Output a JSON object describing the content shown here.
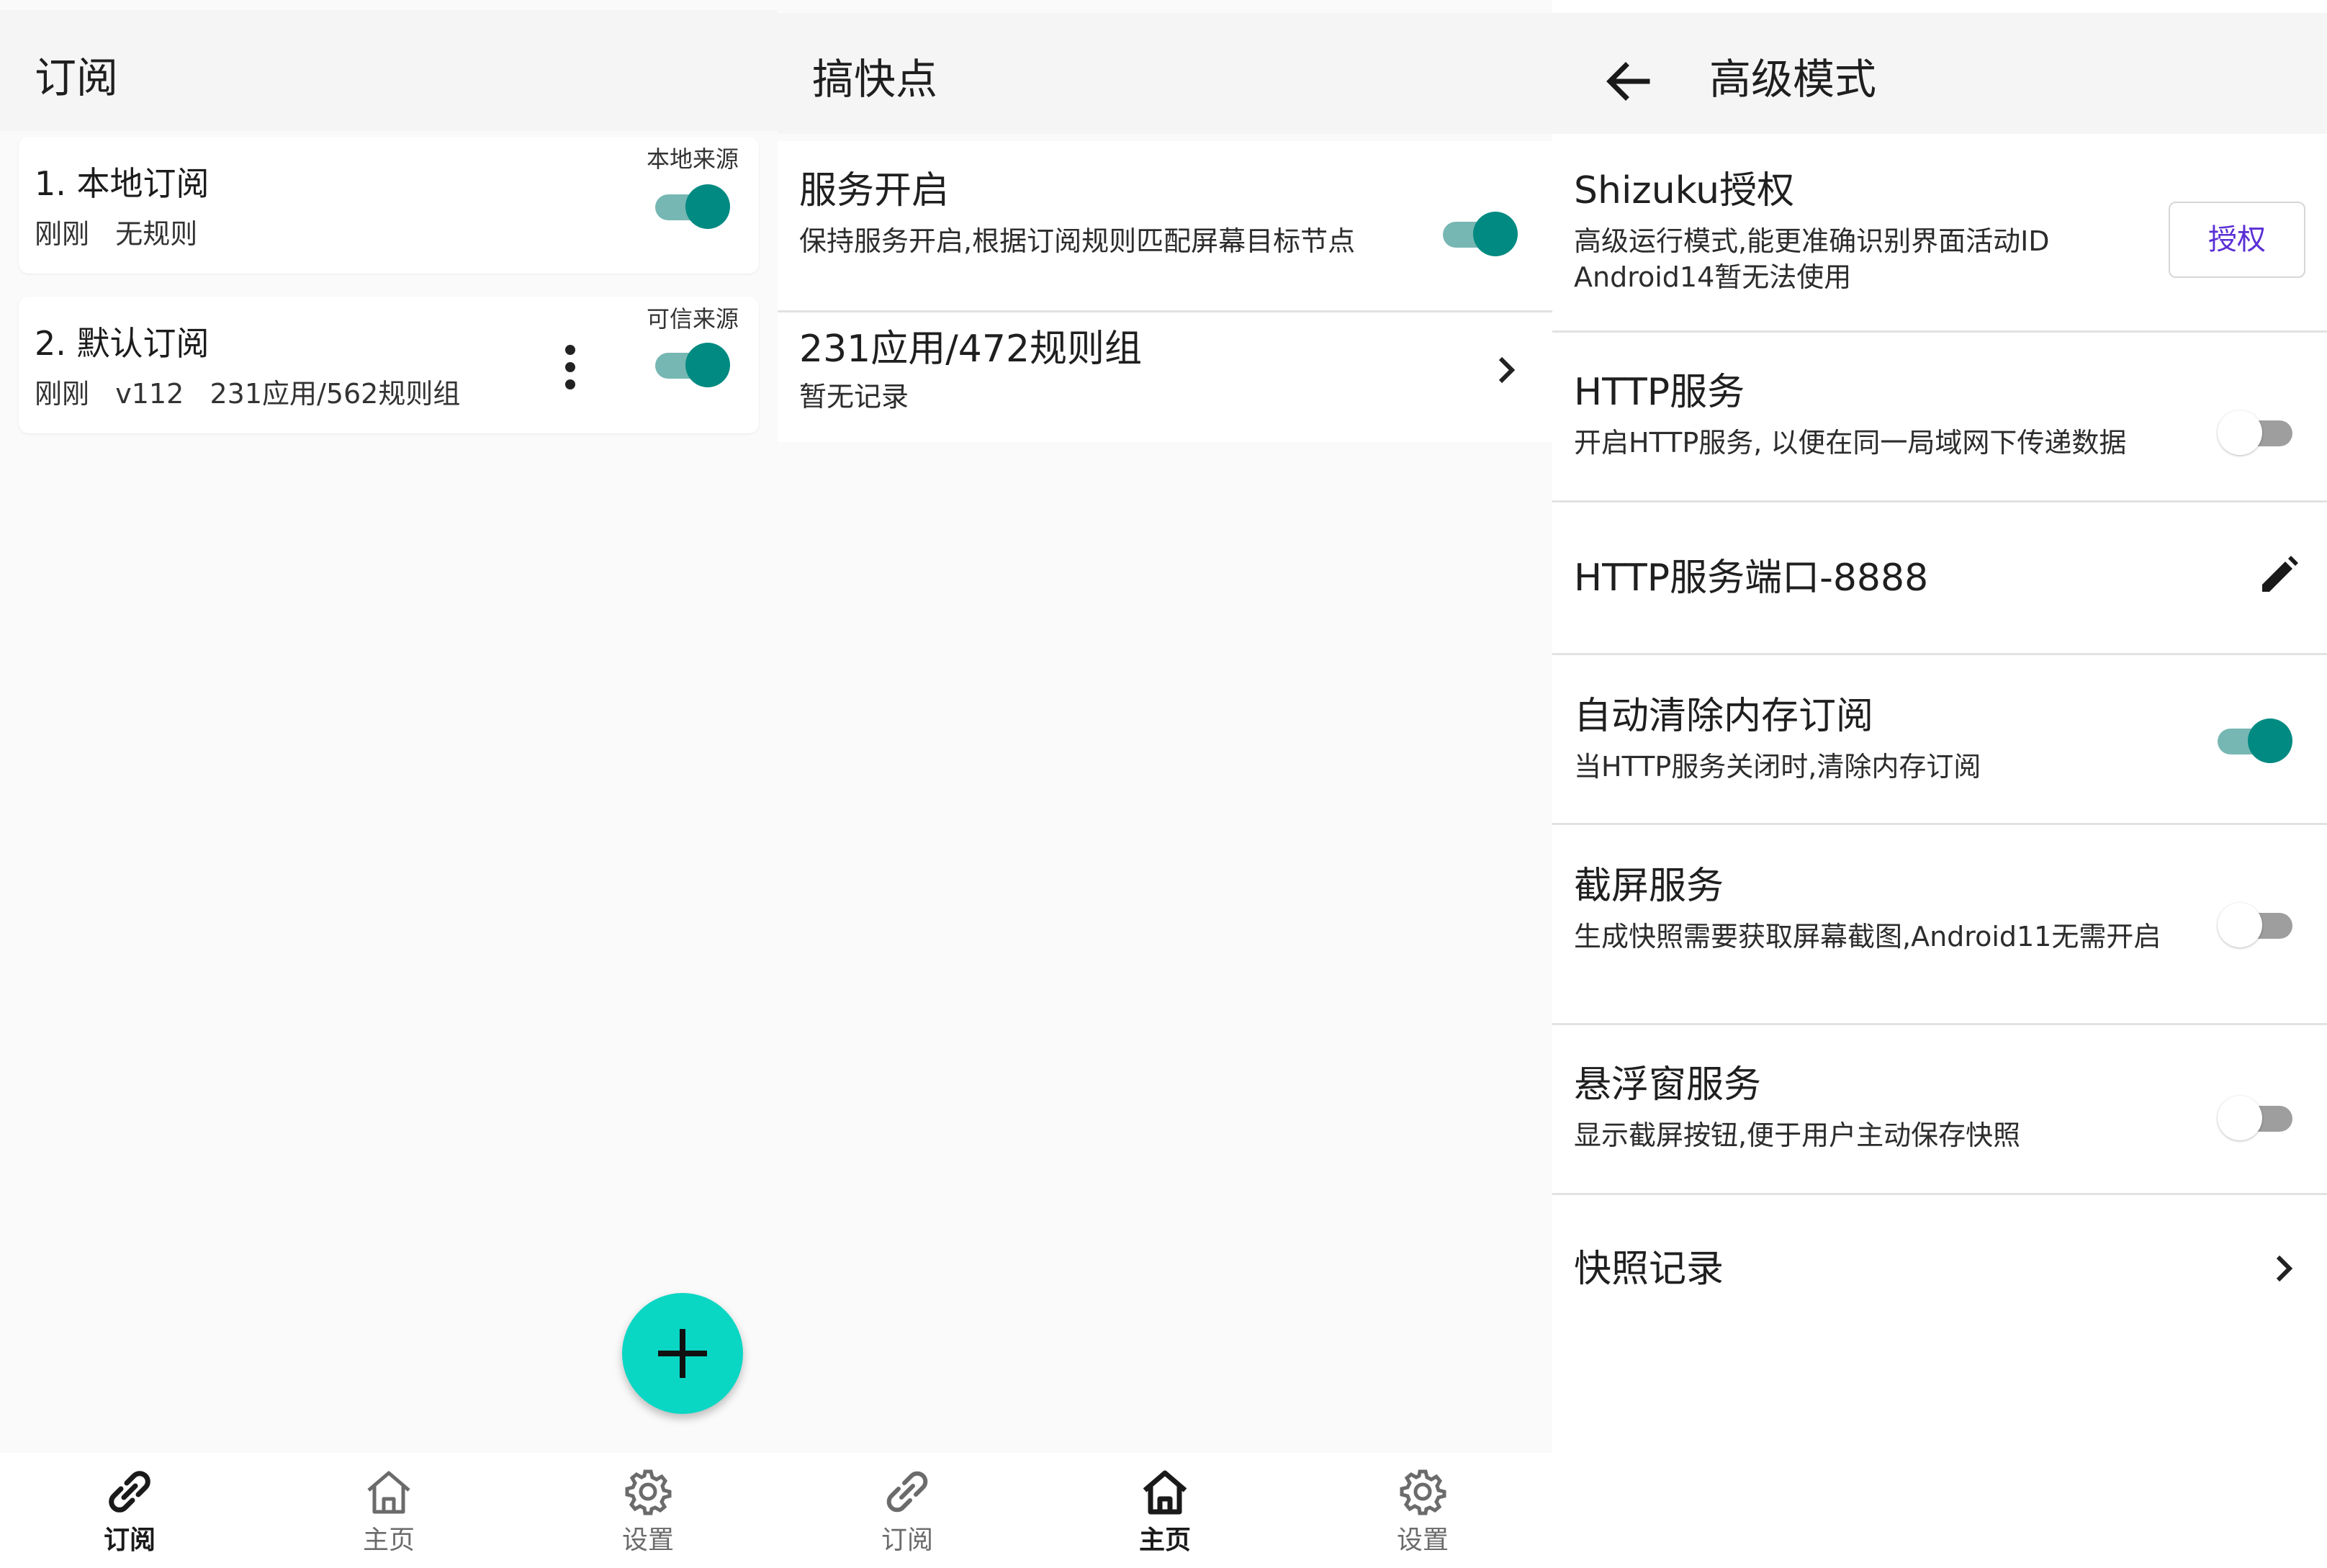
{
  "panels": [
    {
      "title": "订阅",
      "subscriptions": [
        {
          "title": "1. 本地订阅",
          "meta": "刚刚   无规则",
          "tag": "本地来源",
          "enabled": true
        },
        {
          "title": "2. 默认订阅",
          "meta": "刚刚   v112   231应用/562规则组",
          "tag": "可信来源",
          "enabled": true
        }
      ],
      "fab_icon": "plus-icon",
      "nav_active": "订阅"
    },
    {
      "title": "搞快点",
      "service": {
        "title": "服务开启",
        "desc": "保持服务开启,根据订阅规则匹配屏幕目标节点",
        "enabled": true
      },
      "summary": {
        "title": "231应用/472规则组",
        "desc": "暂无记录"
      },
      "nav_active": "主页"
    },
    {
      "title": "高级模式",
      "back_icon": "arrow-left-icon",
      "shizuku": {
        "title": "Shizuku授权",
        "desc_line1": "高级运行模式,能更准确识别界面活动ID",
        "desc_line2": "Android14暂无法使用",
        "button": "授权"
      },
      "http_service": {
        "title": "HTTP服务",
        "desc": "开启HTTP服务, 以便在同一局域网下传递数据",
        "enabled": false
      },
      "http_port": {
        "title": "HTTP服务端口-8888"
      },
      "auto_clear": {
        "title": "自动清除内存订阅",
        "desc": "当HTTP服务关闭时,清除内存订阅",
        "enabled": true
      },
      "screenshot": {
        "title": "截屏服务",
        "desc": "生成快照需要获取屏幕截图,Android11无需开启",
        "enabled": false
      },
      "floating": {
        "title": "悬浮窗服务",
        "desc": "显示截屏按钮,便于用户主动保存快照",
        "enabled": false
      },
      "snapshots": {
        "title": "快照记录"
      }
    }
  ],
  "nav": {
    "subscribe": "订阅",
    "home": "主页",
    "settings": "设置"
  },
  "colors": {
    "accent": "#008a82",
    "fab": "#0ad6c4",
    "auth_text": "#5a2fd6"
  }
}
